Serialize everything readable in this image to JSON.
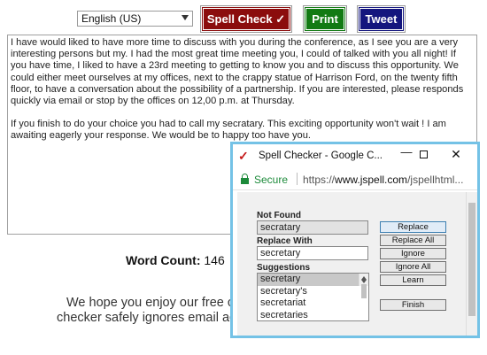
{
  "toolbar": {
    "language": "English (US)",
    "spell_check_label": "Spell Check ✓",
    "print_label": "Print",
    "tweet_label": "Tweet"
  },
  "editor": {
    "paragraph1": "I have would liked to have more time to discuss with you during the conference, as I see you are a very interesting persons but my. I had the most great time meeting you, I could of talked with you all night! If you have time, I liked to have a 23rd meeting to getting to know you and to discuss this opportunity. We could either meet ourselves at my offices, next to the crappy statue of Harrison Ford, on the twenty fifth floor, to have a conversation about the possibility of a partnership. If you are interested, please responds quickly via email or stop by the offices on 12,00 p.m. at Thursday.",
    "paragraph2": "If you finish to do your choice you had to call my secratary. This exciting  opportunity won't wait ! I am awaiting eagerly your response. We would be to happy too have you."
  },
  "word_count": {
    "label": "Word Count:",
    "value": "146"
  },
  "promo": {
    "line1": "We hope you enjoy our free c",
    "line2": "checker safely ignores email ac"
  },
  "popup": {
    "title": "Spell Checker - Google C...",
    "title_icon": "check-icon",
    "secure_label": "Secure",
    "url_prefix": "https://",
    "url_domain": "www.jspell.com",
    "url_rest": "/jspellhtml...",
    "not_found_label": "Not Found",
    "not_found_value": "secratary",
    "replace_with_label": "Replace With",
    "replace_with_value": "secretary",
    "suggestions_label": "Suggestions",
    "suggestions": [
      "secretary",
      "secretary's",
      "secretariat",
      "secretaries"
    ],
    "buttons": {
      "replace": "Replace",
      "replace_all": "Replace All",
      "ignore": "Ignore",
      "ignore_all": "Ignore All",
      "learn": "Learn",
      "finish": "Finish"
    }
  },
  "colors": {
    "spell_check": "#8b0d0d",
    "print": "#127a13",
    "tweet": "#14167e",
    "popup_border": "#74c2e6",
    "secure_green": "#1c8a3a"
  }
}
